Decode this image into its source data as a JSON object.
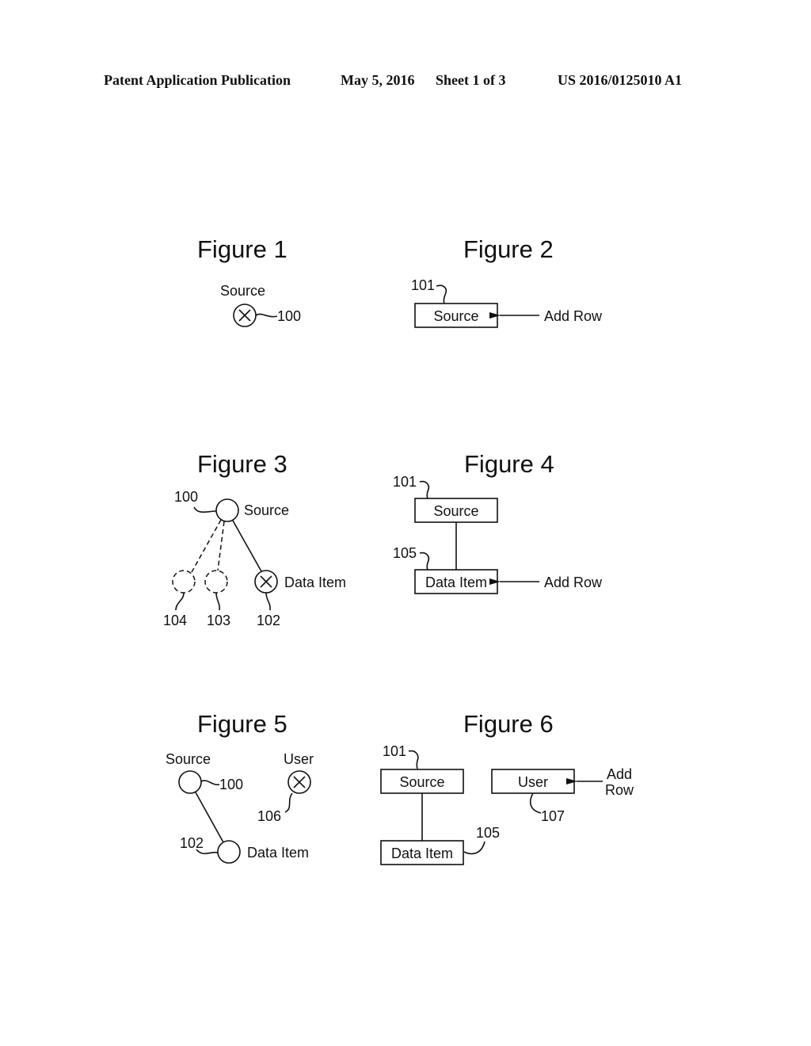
{
  "header": {
    "publication": "Patent Application Publication",
    "date": "May 5, 2016",
    "sheet": "Sheet 1 of 3",
    "number": "US 2016/0125010 A1"
  },
  "figures": {
    "fig1": {
      "title": "Figure 1",
      "node_label": "Source",
      "ref": "100"
    },
    "fig2": {
      "title": "Figure 2",
      "ref": "101",
      "box_label": "Source",
      "arrow_label": "Add Row"
    },
    "fig3": {
      "title": "Figure 3",
      "source_label": "Source",
      "source_ref": "100",
      "data_item_label": "Data Item",
      "refs": [
        "104",
        "103",
        "102"
      ]
    },
    "fig4": {
      "title": "Figure 4",
      "source_ref": "101",
      "source_label": "Source",
      "item_ref": "105",
      "item_label": "Data Item",
      "arrow_label": "Add Row"
    },
    "fig5": {
      "title": "Figure 5",
      "source_label": "Source",
      "source_ref": "100",
      "user_label": "User",
      "user_ref": "106",
      "item_ref": "102",
      "item_label": "Data Item"
    },
    "fig6": {
      "title": "Figure 6",
      "source_ref": "101",
      "source_label": "Source",
      "user_label": "User",
      "user_ref": "107",
      "arrow_label_line1": "Add",
      "arrow_label_line2": "Row",
      "item_ref": "105",
      "item_label": "Data Item"
    }
  }
}
